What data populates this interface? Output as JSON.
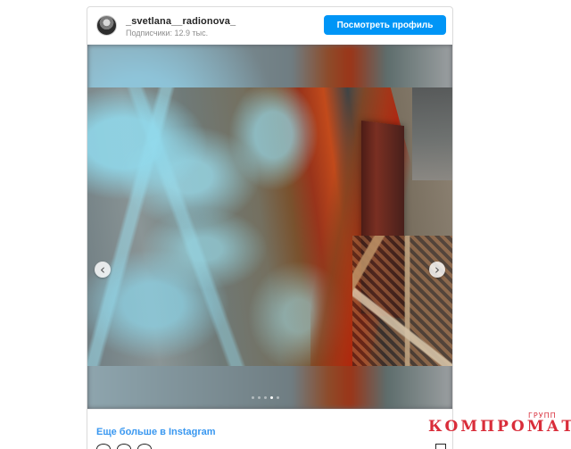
{
  "post": {
    "username": "_svetlana__radionova_",
    "followers_text": "Подписчики: 12.9 тыс.",
    "view_profile_label": "Посмотреть профиль",
    "more_link": "Еще больше в Instagram",
    "carousel": {
      "left_arrow": "‹",
      "right_arrow": "›",
      "slide_count": 5,
      "active_slide": 4
    }
  },
  "watermark": {
    "small": "ГРУПП",
    "main": "КОМПРОМАТ"
  },
  "colors": {
    "button_blue": "#0095f6",
    "link_blue": "#3897f0",
    "watermark_red": "#d92d3a"
  },
  "icons": {
    "avatar": "user-avatar",
    "left": "chevron-left-icon",
    "right": "chevron-right-icon",
    "bookmark": "bookmark-icon"
  }
}
